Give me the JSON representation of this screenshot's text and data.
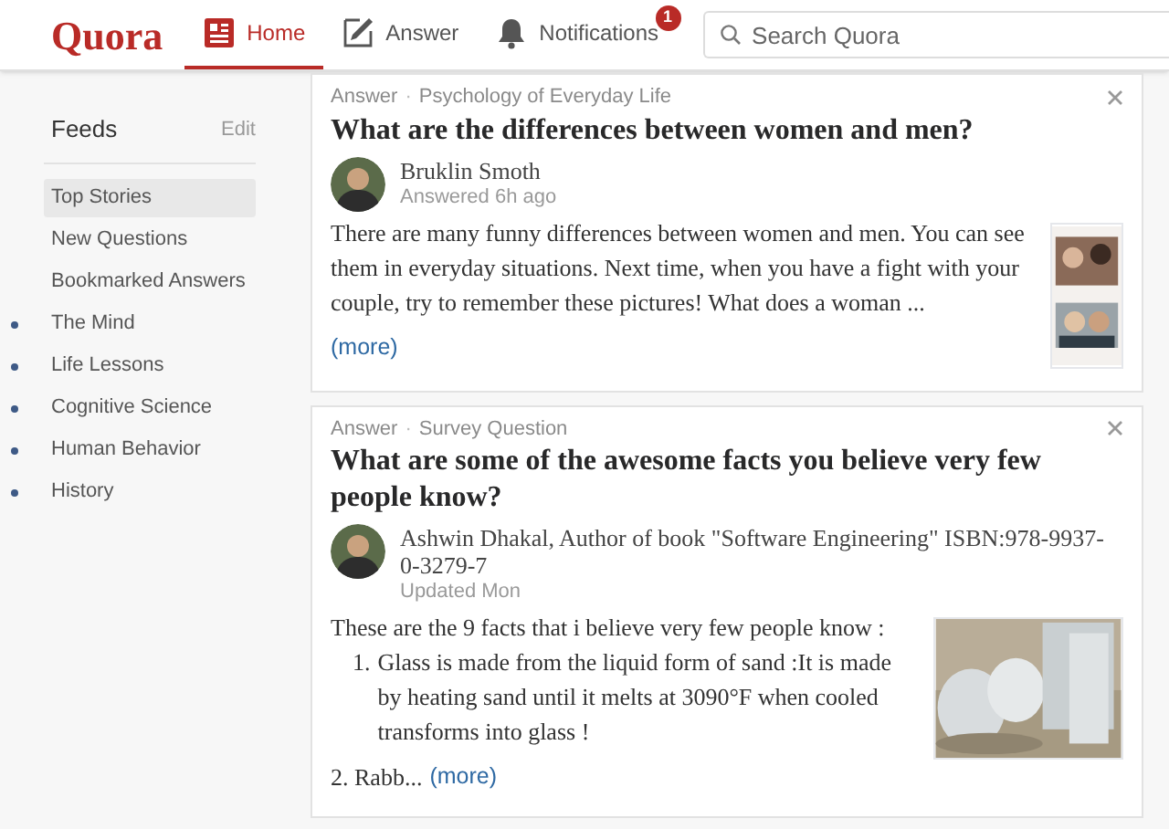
{
  "header": {
    "logo": "Quora",
    "nav": [
      {
        "kind": "home",
        "label": "Home",
        "selected": true
      },
      {
        "kind": "answer",
        "label": "Answer",
        "selected": false
      },
      {
        "kind": "notifications",
        "label": "Notifications",
        "selected": false,
        "badge": "1"
      }
    ],
    "search": {
      "placeholder": "Search Quora"
    }
  },
  "sidebar": {
    "title": "Feeds",
    "edit": "Edit",
    "items": [
      {
        "kind": "feed",
        "label": "Top Stories",
        "selected": true
      },
      {
        "kind": "feed",
        "label": "New Questions",
        "selected": false
      },
      {
        "kind": "feed",
        "label": "Bookmarked Answers",
        "selected": false
      },
      {
        "kind": "topic",
        "label": "The Mind",
        "selected": false
      },
      {
        "kind": "topic",
        "label": "Life Lessons",
        "selected": false
      },
      {
        "kind": "topic",
        "label": "Cognitive Science",
        "selected": false
      },
      {
        "kind": "topic",
        "label": "Human Behavior",
        "selected": false
      },
      {
        "kind": "topic",
        "label": "History",
        "selected": false
      }
    ]
  },
  "cards": [
    {
      "type": "Answer",
      "topic": "Psychology of Everyday Life",
      "question": "What are the differences between women and men?",
      "author": "Bruklin Smoth",
      "timestamp": "Answered 6h ago",
      "separator": "·",
      "picture": {
        "kind": "picture"
      },
      "body": [
        {
          "kind": "text",
          "text": "There are many funny differences between women and men. You can see them in everyday situations. Next time, when you have a fight with your couple, try to remember these pictures! What does a woman ..."
        },
        {
          "kind": "more",
          "link": "(more)"
        }
      ]
    },
    {
      "type": "Answer",
      "topic": "Survey Question",
      "question": "What are some of the awesome facts you believe very few people know?",
      "author": "Ashwin Dhakal, Author of book \"Software Engineering\" ISBN:978-9937-0-3279-7",
      "timestamp": "Updated Mon",
      "separator": "·",
      "picture": {
        "kind": "picture"
      },
      "body": [
        {
          "kind": "text",
          "text": "These are the 9 facts that i believe very few people know :"
        },
        {
          "kind": "list_item",
          "marker": "1.",
          "text": "Glass is made from the liquid form of sand :It is made by heating sand until it melts at 3090°F when cooled transforms into glass !"
        },
        {
          "kind": "more",
          "lead": "2. Rabb...",
          "link": "(more)"
        }
      ]
    }
  ]
}
